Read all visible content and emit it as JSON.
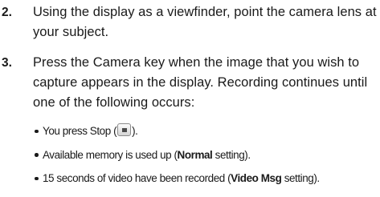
{
  "steps": [
    {
      "number": "2.",
      "text": "Using the display as a viewfinder, point the camera lens at your subject."
    },
    {
      "number": "3.",
      "text": "Press the Camera key when the image that you wish to capture appears in the display. Recording continues until one of the following occurs:"
    }
  ],
  "bullets": {
    "stop": {
      "prefix": "You press Stop (",
      "icon": "stop-icon",
      "suffix": ")."
    },
    "memory": {
      "prefix": "Available memory is used up (",
      "bold": "Normal",
      "suffix": " setting)."
    },
    "video": {
      "prefix": "15 seconds of video have been recorded (",
      "bold": "Video Msg",
      "suffix": " setting)."
    }
  }
}
